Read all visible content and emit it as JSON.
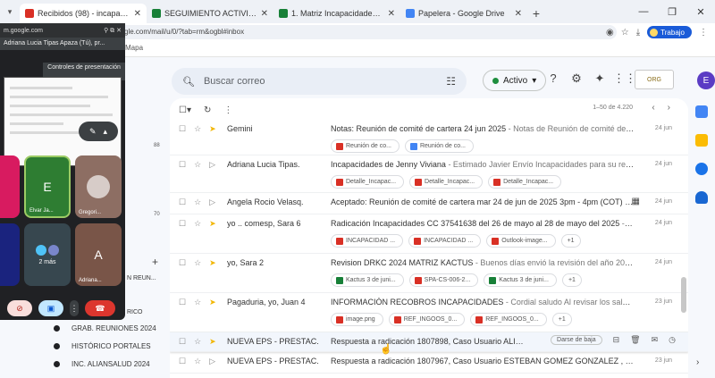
{
  "browser": {
    "tabs": [
      {
        "title": "Recibidos (98) - incapacidades",
        "color": "#d93025",
        "active": true
      },
      {
        "title": "SEGUIMIENTO ACTIVIDADES",
        "color": "#188038",
        "active": false
      },
      {
        "title": "1. Matriz Incapacidades - Hoja",
        "color": "#188038",
        "active": false
      },
      {
        "title": "Papelera - Google Drive",
        "color": "#4285f4",
        "active": false
      }
    ],
    "url": "gle.com/mail/u/0/?tab=rm&ogbl#inbox",
    "bookmark": "Mapa",
    "profile_label": "Trabajo"
  },
  "gmail": {
    "search_placeholder": "Buscar correo",
    "status_label": "Activo",
    "avatar_letter": "E",
    "org_logo_text": "ORG",
    "list_count": "1–50 de 4.220",
    "emails": [
      {
        "sender": "Gemini",
        "subject": "Notas: Reunión de comité de cartera 24 jun 2025",
        "snippet": " - Notas de Reunión de comité de ca...",
        "date": "24 jun",
        "chips": [
          {
            "label": "Reunión de co...",
            "color": "#d93025"
          },
          {
            "label": "Reunión de co...",
            "color": "#4285f4"
          }
        ]
      },
      {
        "sender": "Adriana Lucia Tipas.",
        "subject": "Incapacidades de Jenny Viviana",
        "snippet": " - Estimado Javier Envío Incapacidades para su revisi...",
        "date": "24 jun",
        "chips": [
          {
            "label": "Detalle_Incapac...",
            "color": "#d93025"
          },
          {
            "label": "Detalle_Incapac...",
            "color": "#d93025"
          },
          {
            "label": "Detalle_Incapac...",
            "color": "#d93025"
          }
        ]
      },
      {
        "sender": "Angela Rocio Velasq.",
        "subject": "Aceptado: Reunión de comité de cartera mar 24 de jun de 2025 3pm - 4pm (COT) (Inc...",
        "snippet": "",
        "date": "24 jun",
        "chips": []
      },
      {
        "sender": "yo .. comesp, Sara 6",
        "subject": "Radicación Incapacidades CC 37541638 del 26 de mayo al 28 de mayo del 2025",
        "snippet": " - Sen...",
        "date": "24 jun",
        "chips": [
          {
            "label": "INCAPACIDAD ...",
            "color": "#d93025"
          },
          {
            "label": "INCAPACIDAD ...",
            "color": "#d93025"
          },
          {
            "label": "Outlook-image...",
            "color": "#d93025"
          },
          {
            "label": "+1",
            "color": ""
          }
        ]
      },
      {
        "sender": "yo, Sara 2",
        "subject": "Revision DRKC 2024 MATRIZ KACTUS",
        "snippet": " - Buenos días envió la revisión del año 2024 y la...",
        "date": "24 jun",
        "chips": [
          {
            "label": "Kactus 3 de juni...",
            "color": "#188038"
          },
          {
            "label": "SPA-CS-006-2...",
            "color": "#d93025"
          },
          {
            "label": "Kactus 3 de juni...",
            "color": "#188038"
          },
          {
            "label": "+1",
            "color": ""
          }
        ]
      },
      {
        "sender": "Pagaduria, yo, Juan 4",
        "subject": "INFORMACIÓN RECOBROS INCAPACIDADES",
        "snippet": " - Cordial saludo Al revisar los saldos del...",
        "date": "23 jun",
        "chips": [
          {
            "label": "image.png",
            "color": "#d93025"
          },
          {
            "label": "REF_INGOOS_0...",
            "color": "#d93025"
          },
          {
            "label": "REF_INGOOS_0...",
            "color": "#d93025"
          },
          {
            "label": "+1",
            "color": ""
          }
        ]
      },
      {
        "sender": "NUEVA EPS - PRESTAC.",
        "subject": "Respuesta a radicación 1807898, Caso Usuario ALINA DEL...",
        "snippet": "",
        "date": "",
        "unsubscribe": "Darse de baja",
        "chips": []
      },
      {
        "sender": "NUEVA EPS - PRESTAC.",
        "subject": "Respuesta a radicación 1807967, Caso Usuario ESTEBAN GOMEZ GONZALEZ , CC 103...",
        "snippet": "",
        "date": "23 jun",
        "chips": []
      }
    ],
    "labels": [
      "GRAB. REUNIONES 2024",
      "HISTÓRICO PORTALES",
      "INC. ALIANSALUD 2024"
    ],
    "partial_labels": [
      "N REUN...",
      "RICO"
    ],
    "unread_count": "88",
    "nav_count": "70"
  },
  "meet": {
    "url": "m.google.com",
    "window_title": "Adriana Lucia Tipas Apaza (Tú), pr...",
    "tooltip": "Controles de presentación",
    "tiles": [
      {
        "letter": "E",
        "label": "Elvar Ja..."
      },
      {
        "label": "Gregori..."
      },
      {
        "label": "2 más"
      },
      {
        "letter": "A",
        "label": "Adriana..."
      }
    ]
  }
}
